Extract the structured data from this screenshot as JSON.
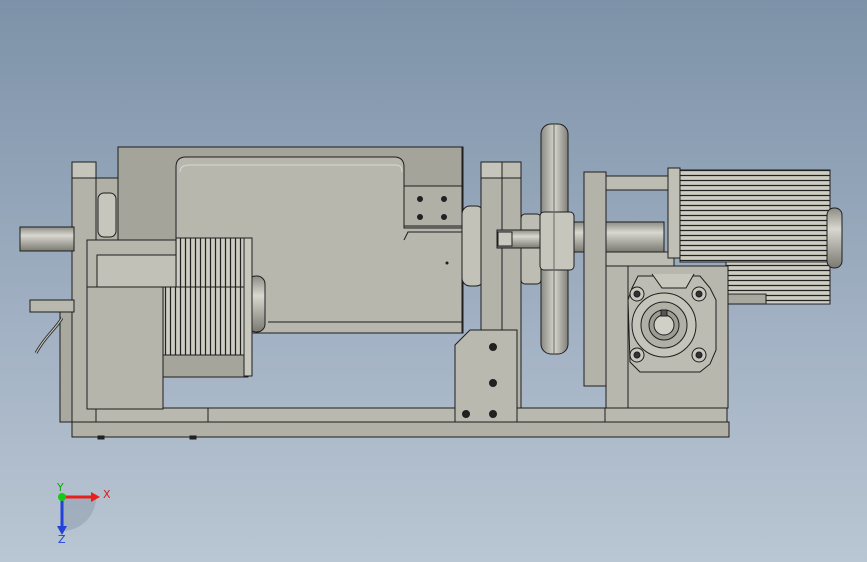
{
  "view": {
    "background_top": "#7d92a8",
    "background_bottom": "#b9c6d3",
    "part_color": "#b4b4aa",
    "edge_color": "#1e1e1e"
  },
  "triad": {
    "x_label": "X",
    "y_label": "Y",
    "z_label": "Z",
    "x_color": "#e8201c",
    "y_color": "#18c818",
    "z_color": "#2340d8"
  },
  "assembly": {
    "components": [
      "base-plate",
      "left-motor",
      "main-housing",
      "output-shaft",
      "support-bracket",
      "flywheel",
      "right-motor",
      "worm-gearbox"
    ]
  }
}
